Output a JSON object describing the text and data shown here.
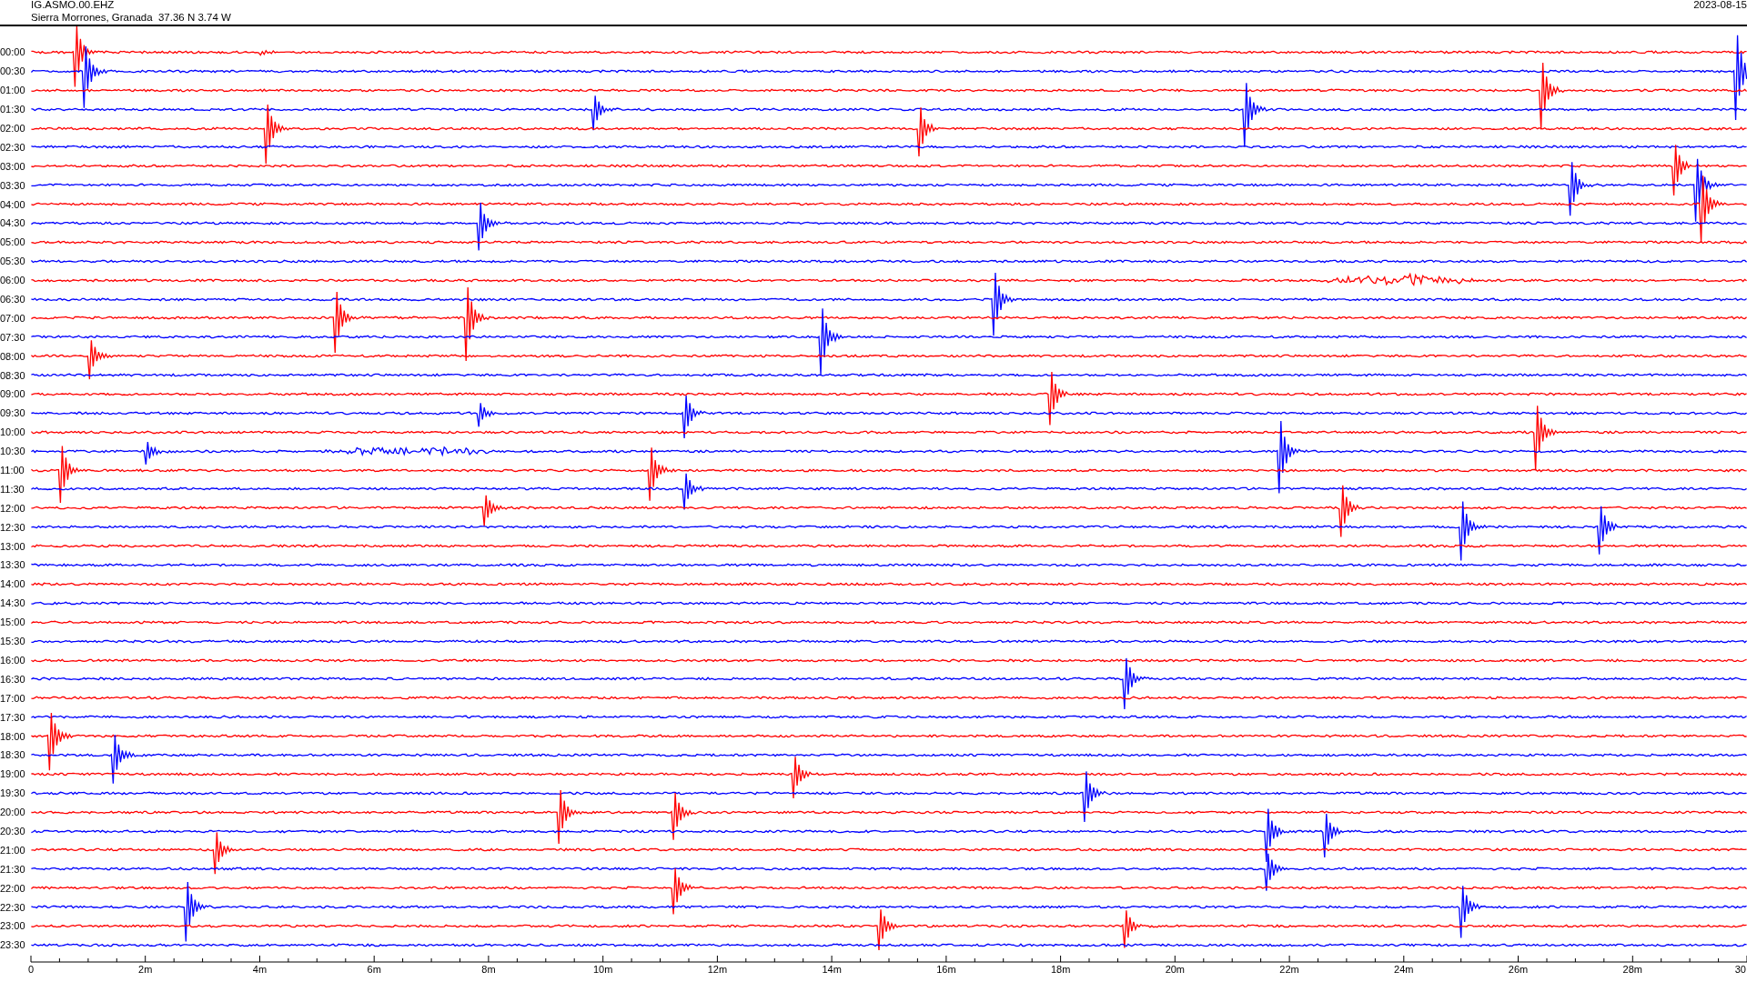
{
  "header": {
    "station": "IG.ASMO.00.EHZ",
    "location": "Sierra Morrones, Granada  37.36 N 3.74 W",
    "date": "2023-08-15"
  },
  "traces": [
    {
      "time": "00:00",
      "color": "#ff0000"
    },
    {
      "time": "00:30",
      "color": "#0000ff"
    },
    {
      "time": "01:00",
      "color": "#ff0000"
    },
    {
      "time": "01:30",
      "color": "#0000ff"
    },
    {
      "time": "02:00",
      "color": "#ff0000"
    },
    {
      "time": "02:30",
      "color": "#0000ff"
    },
    {
      "time": "03:00",
      "color": "#ff0000"
    },
    {
      "time": "03:30",
      "color": "#0000ff"
    },
    {
      "time": "04:00",
      "color": "#ff0000"
    },
    {
      "time": "04:30",
      "color": "#0000ff"
    },
    {
      "time": "05:00",
      "color": "#ff0000"
    },
    {
      "time": "05:30",
      "color": "#0000ff"
    },
    {
      "time": "06:00",
      "color": "#ff0000"
    },
    {
      "time": "06:30",
      "color": "#0000ff"
    },
    {
      "time": "07:00",
      "color": "#ff0000"
    },
    {
      "time": "07:30",
      "color": "#0000ff"
    },
    {
      "time": "08:00",
      "color": "#ff0000"
    },
    {
      "time": "08:30",
      "color": "#0000ff"
    },
    {
      "time": "09:00",
      "color": "#ff0000"
    },
    {
      "time": "09:30",
      "color": "#0000ff"
    },
    {
      "time": "10:00",
      "color": "#ff0000"
    },
    {
      "time": "10:30",
      "color": "#0000ff"
    },
    {
      "time": "11:00",
      "color": "#ff0000"
    },
    {
      "time": "11:30",
      "color": "#0000ff"
    },
    {
      "time": "12:00",
      "color": "#ff0000"
    },
    {
      "time": "12:30",
      "color": "#0000ff"
    },
    {
      "time": "13:00",
      "color": "#ff0000"
    },
    {
      "time": "13:30",
      "color": "#0000ff"
    },
    {
      "time": "14:00",
      "color": "#ff0000"
    },
    {
      "time": "14:30",
      "color": "#0000ff"
    },
    {
      "time": "15:00",
      "color": "#ff0000"
    },
    {
      "time": "15:30",
      "color": "#0000ff"
    },
    {
      "time": "16:00",
      "color": "#ff0000"
    },
    {
      "time": "16:30",
      "color": "#0000ff"
    },
    {
      "time": "17:00",
      "color": "#ff0000"
    },
    {
      "time": "17:30",
      "color": "#0000ff"
    },
    {
      "time": "18:00",
      "color": "#ff0000"
    },
    {
      "time": "18:30",
      "color": "#0000ff"
    },
    {
      "time": "19:00",
      "color": "#ff0000"
    },
    {
      "time": "19:30",
      "color": "#0000ff"
    },
    {
      "time": "20:00",
      "color": "#ff0000"
    },
    {
      "time": "20:30",
      "color": "#0000ff"
    },
    {
      "time": "21:00",
      "color": "#ff0000"
    },
    {
      "time": "21:30",
      "color": "#0000ff"
    },
    {
      "time": "22:00",
      "color": "#ff0000"
    },
    {
      "time": "22:30",
      "color": "#0000ff"
    },
    {
      "time": "23:00",
      "color": "#ff0000"
    },
    {
      "time": "23:30",
      "color": "#0000ff"
    }
  ],
  "x_axis": {
    "ticks": [
      "0",
      "2m",
      "4m",
      "6m",
      "8m",
      "10m",
      "12m",
      "14m",
      "16m",
      "18m",
      "20m",
      "22m",
      "24m",
      "26m",
      "28m",
      "30"
    ]
  }
}
